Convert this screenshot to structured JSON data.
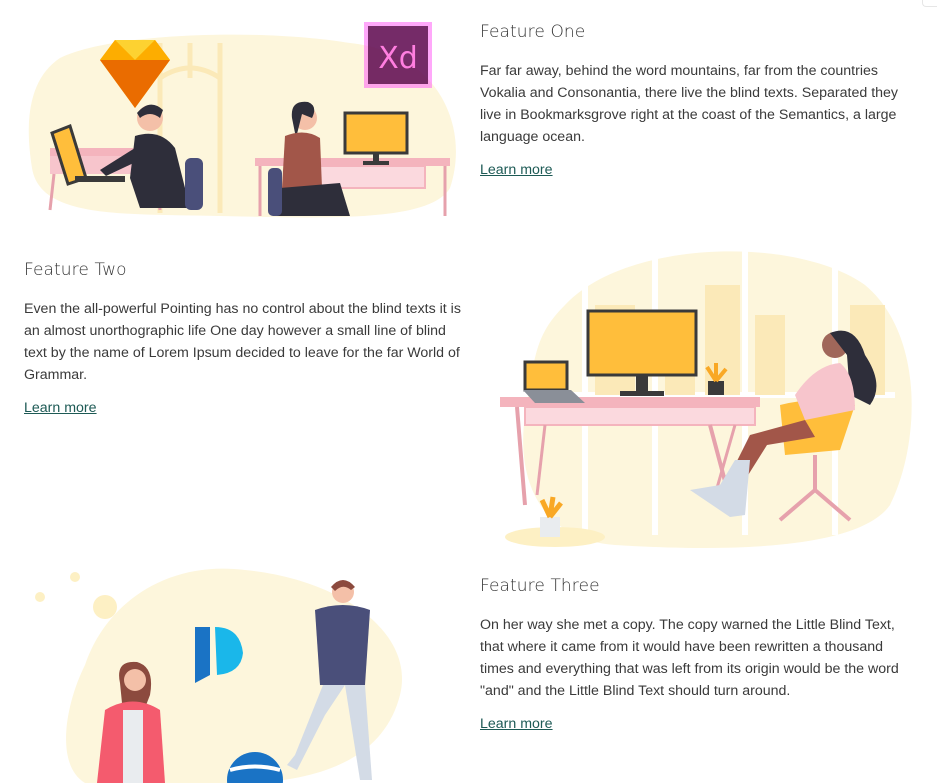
{
  "features": [
    {
      "title": "Feature One",
      "description": "Far far away, behind the word mountains, far from the countries Vokalia and Consonantia, there live the blind texts. Separated they live in Bookmarksgrove right at the coast of the Semantics, a large language ocean.",
      "link": "Learn more"
    },
    {
      "title": "Feature Two",
      "description": "Even the all-powerful Pointing has no control about the blind texts it is an almost unorthographic life One day however a small line of blind text by the name of Lorem Ipsum decided to leave for the far World of Grammar.",
      "link": "Learn more"
    },
    {
      "title": "Feature Three",
      "description": "On her way she met a copy. The copy warned the Little Blind Text, that where it came from it would have been rewritten a thousand times and everything that was left from its origin would be the word \"and\" and the Little Blind Text should turn around.",
      "link": "Learn more"
    }
  ],
  "illustrations": {
    "xd_logo_text": "Xd"
  },
  "colors": {
    "link": "#1d5a55",
    "blob": "#fdf6dc",
    "accent_yellow": "#ffbe3b",
    "desk_pink": "#f4b4bd"
  }
}
